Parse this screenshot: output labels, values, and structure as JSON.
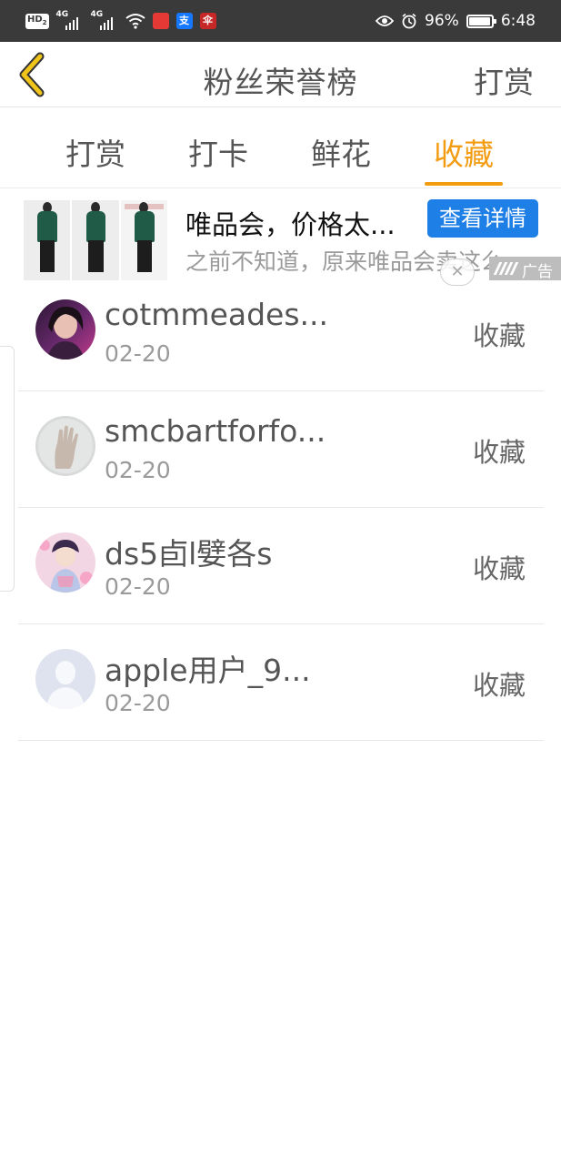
{
  "status_bar": {
    "hd_label": "HD",
    "hd_sub": "2",
    "net1": "4G",
    "net2": "4G",
    "app_badges": [
      "",
      "支",
      "伞"
    ],
    "battery_percent": "96%",
    "battery_level": 0.96,
    "time": "6:48"
  },
  "nav": {
    "title": "粉丝荣誉榜",
    "right_action": "打赏"
  },
  "tabs": [
    {
      "label": "打赏",
      "active": false
    },
    {
      "label": "打卡",
      "active": false
    },
    {
      "label": "鲜花",
      "active": false
    },
    {
      "label": "收藏",
      "active": true
    }
  ],
  "ad": {
    "title": "唯品会，价格太...",
    "button": "查看详情",
    "description": "之前不知道，原来唯品会卖这么",
    "close_symbol": "✕",
    "tag": "广告"
  },
  "list": [
    {
      "name": "cotmmeades...",
      "date": "02-20",
      "action": "收藏",
      "avatar": "photo-girl"
    },
    {
      "name": "smcbartforfo...",
      "date": "02-20",
      "action": "收藏",
      "avatar": "photo-hand"
    },
    {
      "name": "ds5卣l嬖各s",
      "date": "02-20",
      "action": "收藏",
      "avatar": "photo-anime"
    },
    {
      "name": "apple用户_9...",
      "date": "02-20",
      "action": "收藏",
      "avatar": "default-avatar"
    }
  ],
  "colors": {
    "accent": "#f39c12",
    "status_bar": "#3a3a3a",
    "ad_button": "#1e7fe6",
    "back_icon": "#f0c419"
  }
}
